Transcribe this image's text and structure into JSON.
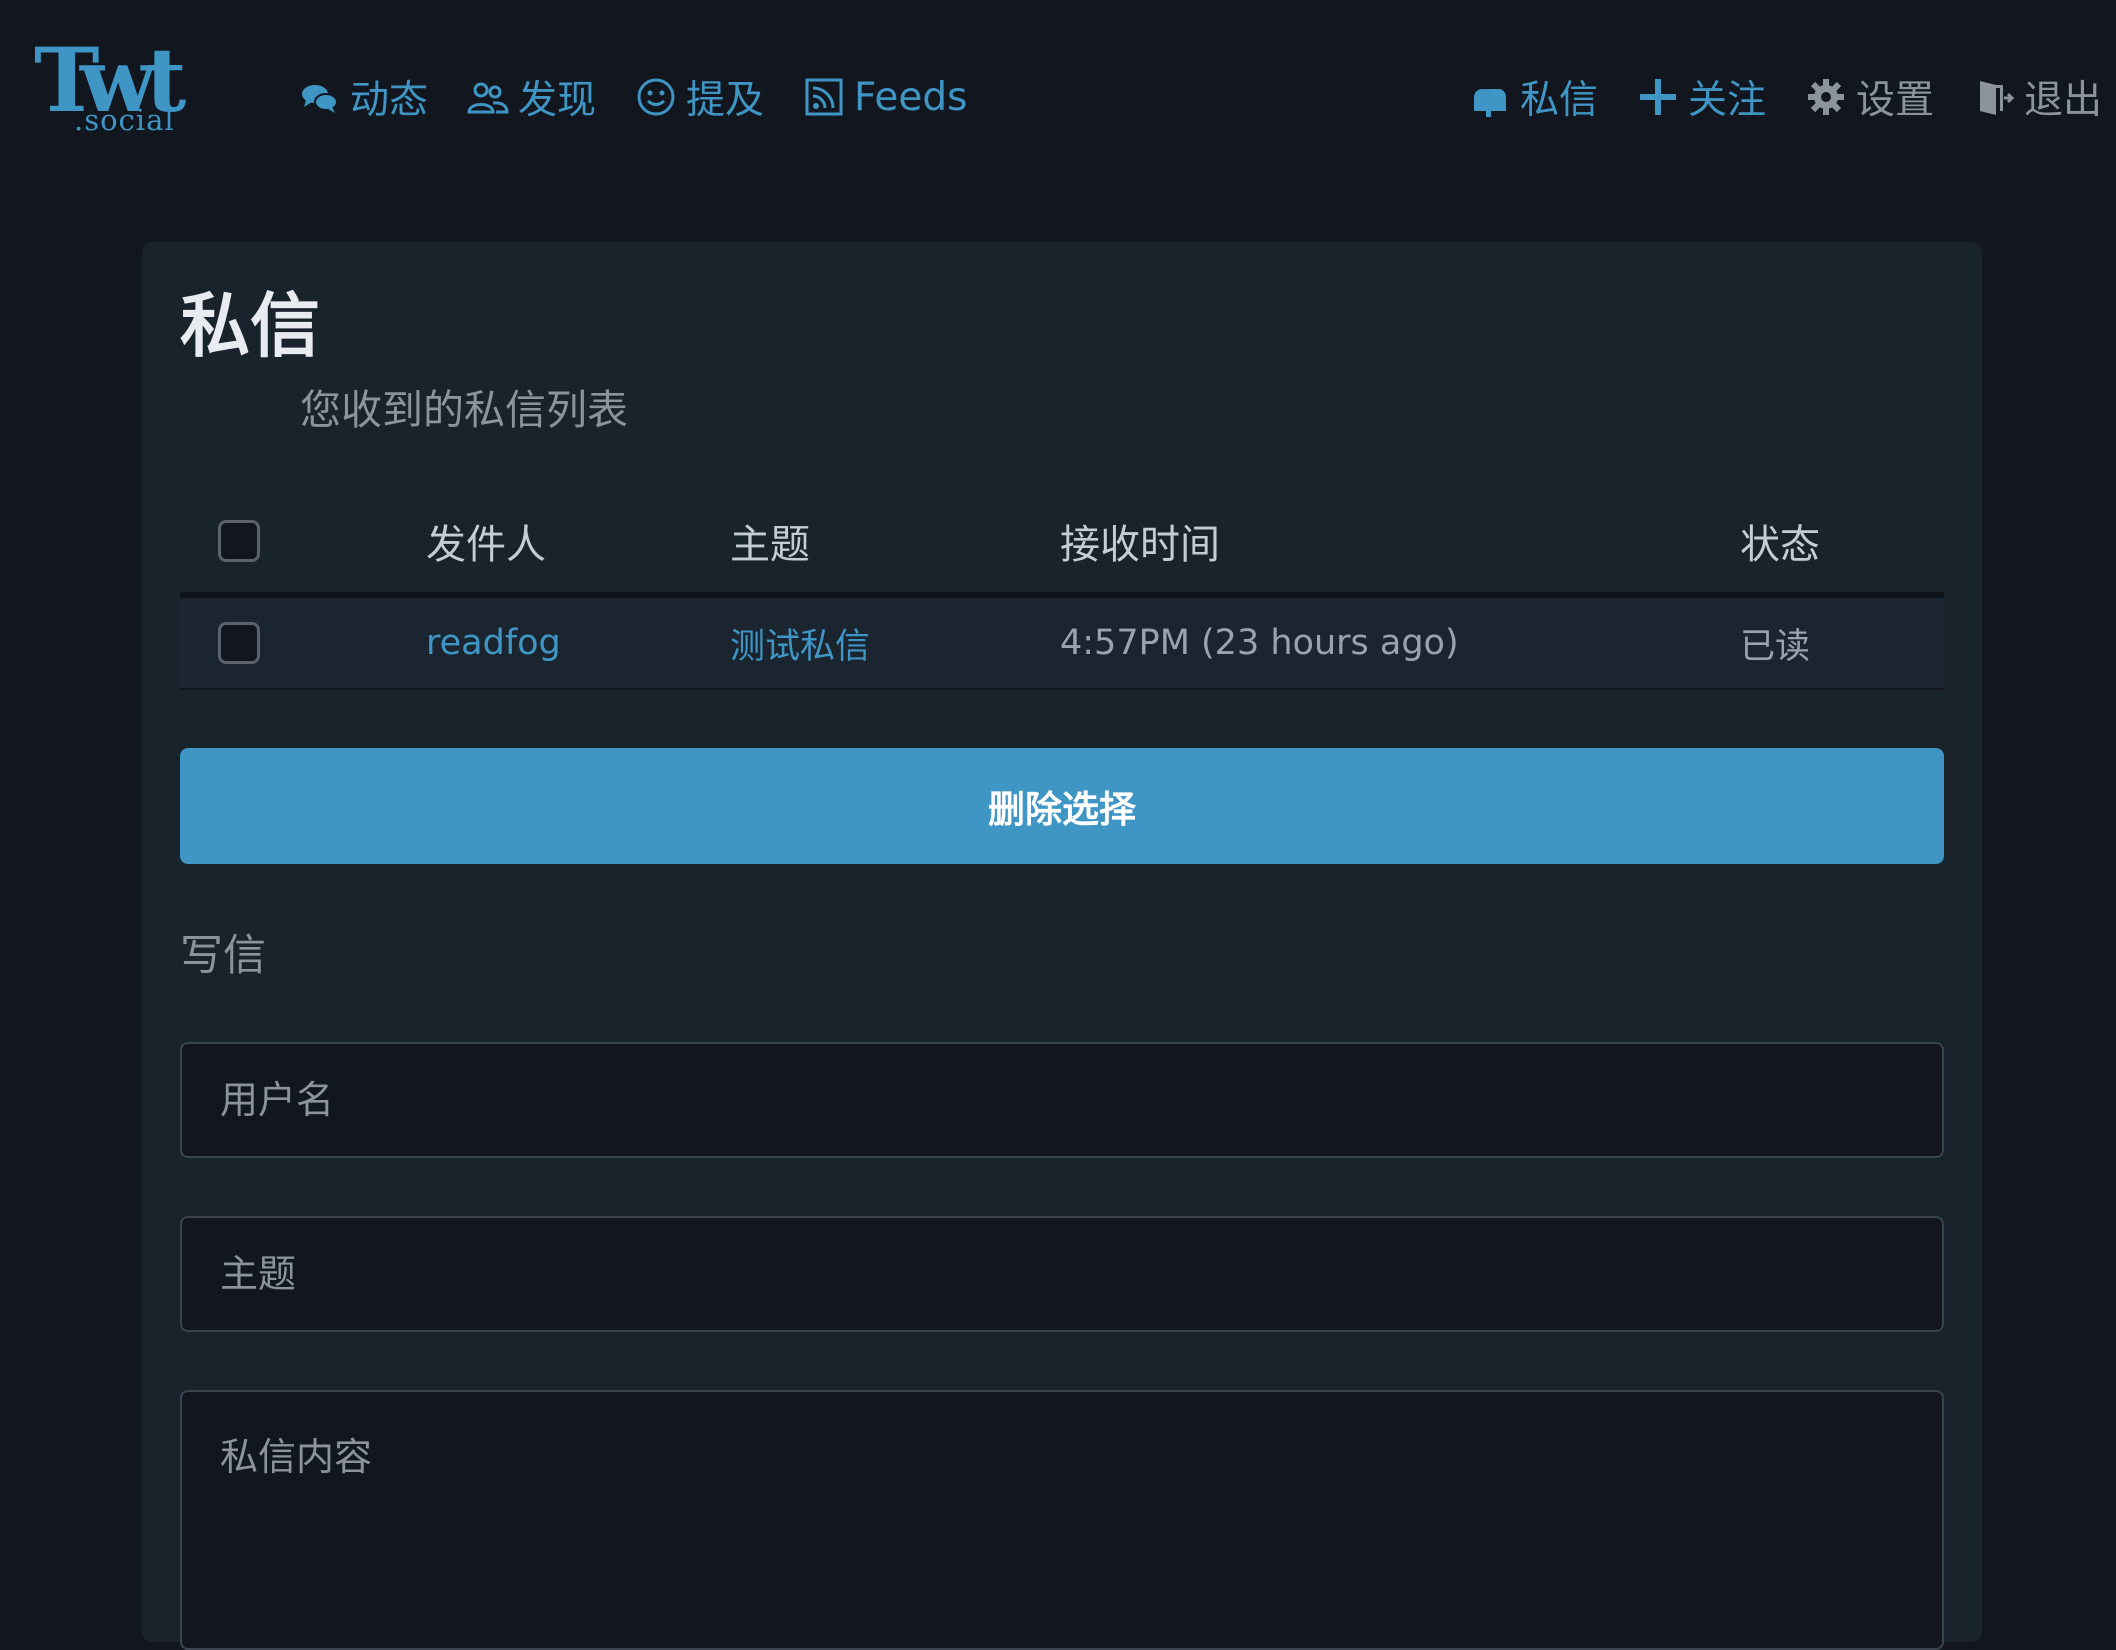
{
  "brand": {
    "logo_main": "Twt",
    "logo_sub": ".social",
    "accent_color": "#3f95c4"
  },
  "nav": {
    "left": [
      {
        "label": "动态",
        "icon": "comments-icon"
      },
      {
        "label": "发现",
        "icon": "users-icon"
      },
      {
        "label": "提及",
        "icon": "smile-icon"
      },
      {
        "label": "Feeds",
        "icon": "rss-icon"
      }
    ],
    "right": [
      {
        "label": "私信",
        "icon": "mailbox-icon"
      },
      {
        "label": "关注",
        "icon": "plus-icon"
      },
      {
        "label": "设置",
        "icon": "gear-icon"
      },
      {
        "label": "退出",
        "icon": "door-icon"
      }
    ]
  },
  "page": {
    "title": "私信",
    "subtitle": "您收到的私信列表"
  },
  "table": {
    "headers": {
      "sender": "发件人",
      "subject": "主题",
      "received": "接收时间",
      "status": "状态"
    },
    "rows": [
      {
        "sender": "readfog",
        "subject": "测试私信",
        "received": "4:57PM  (23 hours ago)",
        "status": "已读",
        "checked": false
      }
    ]
  },
  "actions": {
    "delete_label": "删除选择"
  },
  "compose": {
    "heading": "写信",
    "username_placeholder": "用户名",
    "subject_placeholder": "主题",
    "body_placeholder": "私信内容"
  }
}
